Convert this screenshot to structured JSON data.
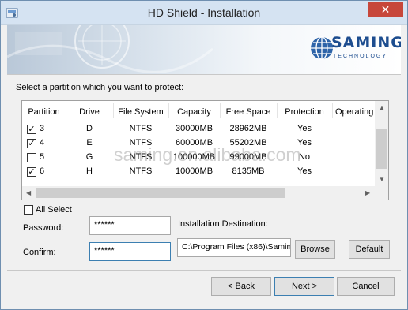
{
  "window": {
    "title": "HD Shield - Installation",
    "close_glyph": "✕"
  },
  "logo": {
    "main": "SAMING",
    "sub": "TECHNOLOGY"
  },
  "instruction": "Select a partition which you want to protect:",
  "table": {
    "columns": [
      "Partition",
      "Drive",
      "File System",
      "Capacity",
      "Free Space",
      "Protection",
      "Operating"
    ],
    "rows": [
      {
        "checked": true,
        "partition": "3",
        "drive": "D",
        "fs": "NTFS",
        "capacity": "30000MB",
        "free": "28962MB",
        "protection": "Yes"
      },
      {
        "checked": true,
        "partition": "4",
        "drive": "E",
        "fs": "NTFS",
        "capacity": "60000MB",
        "free": "55202MB",
        "protection": "Yes"
      },
      {
        "checked": false,
        "partition": "5",
        "drive": "G",
        "fs": "NTFS",
        "capacity": "100000MB",
        "free": "99000MB",
        "protection": "No"
      },
      {
        "checked": true,
        "partition": "6",
        "drive": "H",
        "fs": "NTFS",
        "capacity": "10000MB",
        "free": "8135MB",
        "protection": "Yes"
      }
    ]
  },
  "all_select": {
    "label": "All Select",
    "checked": false
  },
  "password": {
    "label": "Password:",
    "value": "******"
  },
  "confirm": {
    "label": "Confirm:",
    "value": "******"
  },
  "destination": {
    "label": "Installation Destination:",
    "value": "C:\\Program Files (x86)\\Samin"
  },
  "buttons": {
    "browse": "Browse",
    "default": "Default",
    "back": "< Back",
    "next": "Next >",
    "cancel": "Cancel"
  },
  "watermark": "saming.en.alibaba.com",
  "colors": {
    "accent": "#3c7fb1",
    "close": "#c7473b",
    "logo": "#1d4d8f"
  }
}
